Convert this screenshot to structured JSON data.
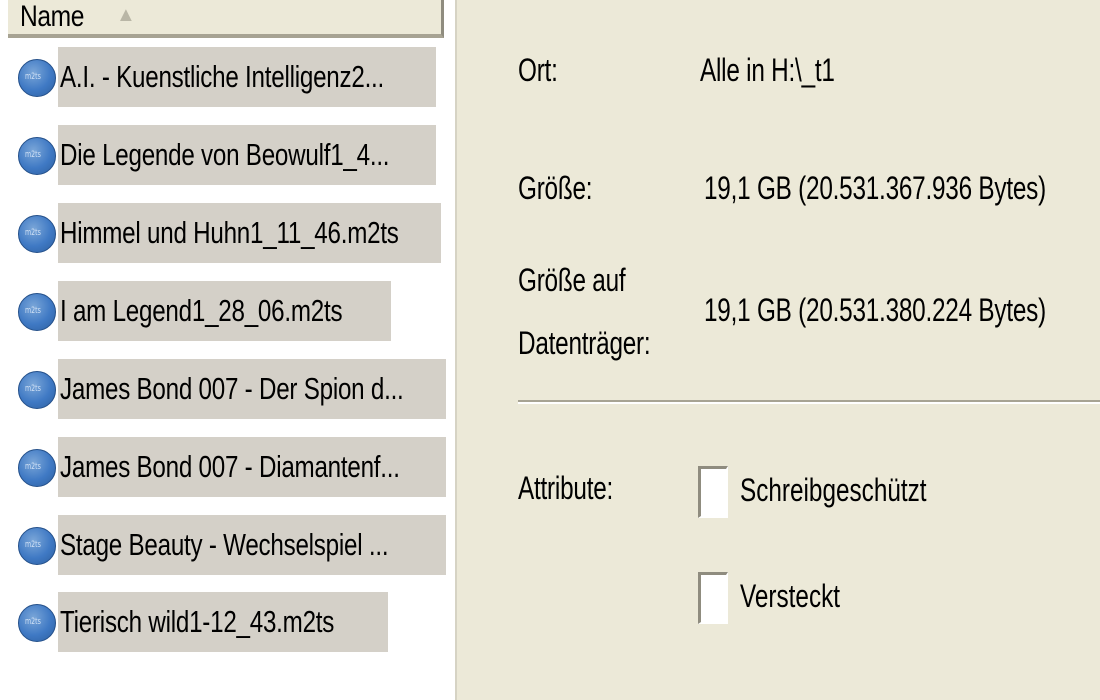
{
  "file_list": {
    "column_header": "Name",
    "files": [
      "A.I. - Kuenstliche Intelligenz2...",
      "Die Legende von Beowulf1_4...",
      "Himmel und Huhn1_11_46.m2ts",
      "I am Legend1_28_06.m2ts",
      "James Bond 007 - Der Spion d...",
      "James Bond 007 - Diamantenf...",
      "Stage Beauty - Wechselspiel ...",
      "Tierisch wild1-12_43.m2ts"
    ]
  },
  "properties": {
    "location_label": "Ort:",
    "location_value": "Alle in H:\\_t1",
    "size_label": "Größe:",
    "size_value": "19,1 GB (20.531.367.936 Bytes)",
    "disk_size_label_line1": "Größe auf",
    "disk_size_label_line2": "Datenträger:",
    "disk_size_value": "19,1 GB (20.531.380.224 Bytes)",
    "attributes_label": "Attribute:",
    "read_only_label": "Schreibgeschützt",
    "hidden_label": "Versteckt"
  },
  "colors": {
    "selection": "#d4d0c8",
    "panel_background": "#ece9d8",
    "icon_blue": "#3f79c4"
  }
}
